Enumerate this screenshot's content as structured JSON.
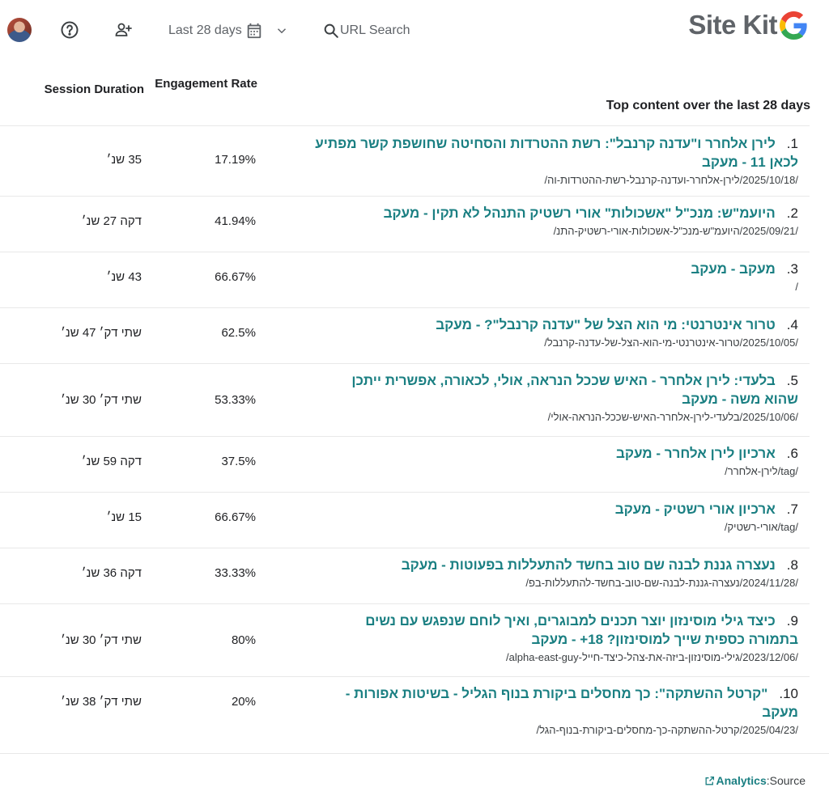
{
  "header": {
    "date_range": "Last 28 days",
    "search_placeholder": "URL Search",
    "logo_text": "Site Kit"
  },
  "table": {
    "col_duration": "Session Duration",
    "col_engagement": "Engagement Rate",
    "col_title": "Top content over the last 28 days",
    "rows": [
      {
        "num": "1.",
        "title": "לירן אלחרר ו\"עדנה קרנבל\": רשת ההטרדות והסחיטה שחושפת קשר מפתיע לכאן 11 - מעקב",
        "url": "/2025/10/18/לירן-אלחרר-ועדנה-קרנבל-רשת-ההטרדות-וה/",
        "engagement": "17.19%",
        "duration": "35 שנ׳"
      },
      {
        "num": "2.",
        "title": "היועמ\"ש: מנכ\"ל \"אשכולות\" אורי רשטיק התנהל לא תקין - מעקב",
        "url": "/2025/09/21/היועמ\"ש-מנכ\"ל-אשכולות-אורי-רשטיק-התנ/",
        "engagement": "41.94%",
        "duration": "דקה 27 שנ׳"
      },
      {
        "num": "3.",
        "title": "מעקב - מעקב",
        "url": "/",
        "engagement": "66.67%",
        "duration": "43 שנ׳"
      },
      {
        "num": "4.",
        "title": "טרור אינטרנטי: מי הוא הצל של \"עדנה קרנבל\"? - מעקב",
        "url": "/2025/10/05/טרור-אינטרנטי-מי-הוא-הצל-של-עדנה-קרנבל/",
        "engagement": "62.5%",
        "duration": "שתי דק׳ 47 שנ׳"
      },
      {
        "num": "5.",
        "title": "בלעדי: לירן אלחרר - האיש שככל הנראה, אולי, לכאורה, אפשרית ייתכן שהוא משה - מעקב",
        "url": "/2025/10/06/בלעדי-לירן-אלחרר-האיש-שככל-הנראה-אולי/",
        "engagement": "53.33%",
        "duration": "שתי דק׳ 30 שנ׳"
      },
      {
        "num": "6.",
        "title": "ארכיון לירן אלחרר - מעקב",
        "url": "/tag/לירן-אלחרר/",
        "engagement": "37.5%",
        "duration": "דקה 59 שנ׳"
      },
      {
        "num": "7.",
        "title": "ארכיון אורי רשטיק - מעקב",
        "url": "/tag/אורי-רשטיק/",
        "engagement": "66.67%",
        "duration": "15 שנ׳"
      },
      {
        "num": "8.",
        "title": "נעצרה גננת לבנה שם טוב בחשד להתעללות בפעוטות - מעקב",
        "url": "/2024/11/28/נעצרה-גננת-לבנה-שם-טוב-בחשד-להתעללות-בפ/",
        "engagement": "33.33%",
        "duration": "דקה 36 שנ׳"
      },
      {
        "num": "9.",
        "title": "כיצד גילי מוסינזון יוצר תכנים למבוגרים, ואיך לוחם שנפגש עם נשים בתמורה כספית שייך למוסינזון? 18+ - מעקב",
        "url": "/2023/12/06/גילי-מוסינזון-ביזה-את-צהל-כיצד-חייל-alpha-east-guy/",
        "engagement": "80%",
        "duration": "שתי דק׳ 30 שנ׳"
      },
      {
        "num": "10.",
        "title": "\"קרטל ההשתקה\": כך מחסלים ביקורת בנוף הגליל - בשיטות אפורות - מעקב",
        "url": "/2025/04/23/קרטל-ההשתקה-כך-מחסלים-ביקורת-בנוף-הגל/",
        "engagement": "20%",
        "duration": "שתי דק׳ 38 שנ׳"
      }
    ]
  },
  "footer": {
    "source_label": "Source:",
    "source_link": "Analytics"
  }
}
